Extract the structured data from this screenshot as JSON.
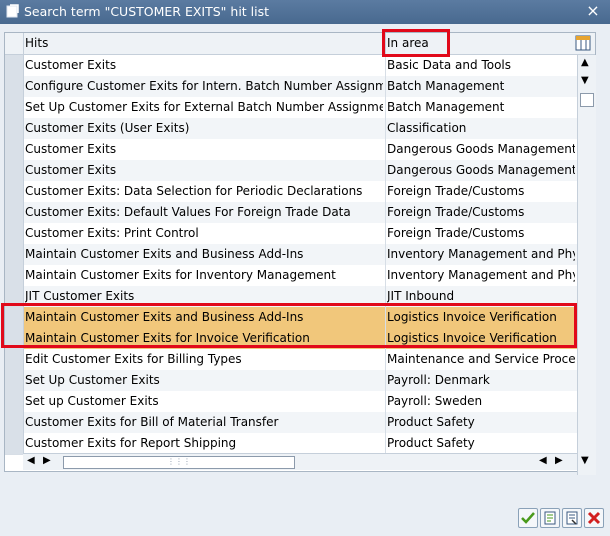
{
  "window": {
    "title": "Search term \"CUSTOMER EXITS\" hit list",
    "close_label": "×"
  },
  "grid": {
    "columns": [
      "Hits",
      "In area"
    ],
    "rows": [
      {
        "hit": "Customer Exits",
        "area": "Basic Data and Tools"
      },
      {
        "hit": "Configure Customer Exits for Intern. Batch Number Assignment",
        "area": "Batch Management"
      },
      {
        "hit": "Set Up Customer Exits for External Batch Number Assignment",
        "area": "Batch Management"
      },
      {
        "hit": "Customer Exits (User Exits)",
        "area": "Classification"
      },
      {
        "hit": "Customer Exits",
        "area": "Dangerous Goods Management"
      },
      {
        "hit": "Customer Exits",
        "area": "Dangerous Goods Management"
      },
      {
        "hit": "Customer Exits: Data Selection for Periodic Declarations",
        "area": "Foreign Trade/Customs"
      },
      {
        "hit": "Customer Exits: Default Values For Foreign Trade Data",
        "area": "Foreign Trade/Customs"
      },
      {
        "hit": "Customer Exits: Print Control",
        "area": "Foreign Trade/Customs"
      },
      {
        "hit": "Maintain Customer Exits and Business Add-Ins",
        "area": "Inventory Management and Physic"
      },
      {
        "hit": "Maintain Customer Exits for Inventory Management",
        "area": "Inventory Management and Physic"
      },
      {
        "hit": "JIT Customer Exits",
        "area": "JIT Inbound"
      },
      {
        "hit": "Maintain Customer Exits and Business Add-Ins",
        "area": "Logistics Invoice Verification"
      },
      {
        "hit": "Maintain Customer Exits for Invoice Verification",
        "area": "Logistics Invoice Verification"
      },
      {
        "hit": "Edit Customer Exits for Billing Types",
        "area": "Maintenance and Service Processir"
      },
      {
        "hit": "Set Up Customer Exits",
        "area": "Payroll: Denmark"
      },
      {
        "hit": "Set up Customer Exits",
        "area": "Payroll: Sweden"
      },
      {
        "hit": "Customer Exits for Bill of Material Transfer",
        "area": "Product Safety"
      },
      {
        "hit": "Customer Exits for Report Shipping",
        "area": "Product Safety"
      }
    ],
    "highlighted_rows": [
      12,
      13
    ],
    "highlight_color": "#f1c77b",
    "annotation_color": "#e1091a"
  },
  "icons": {
    "title": "window-icon",
    "config": "column-config-icon",
    "confirm": "green-check-icon",
    "export1": "copy-icon",
    "export2": "select-icon",
    "cancel": "red-x-icon"
  }
}
